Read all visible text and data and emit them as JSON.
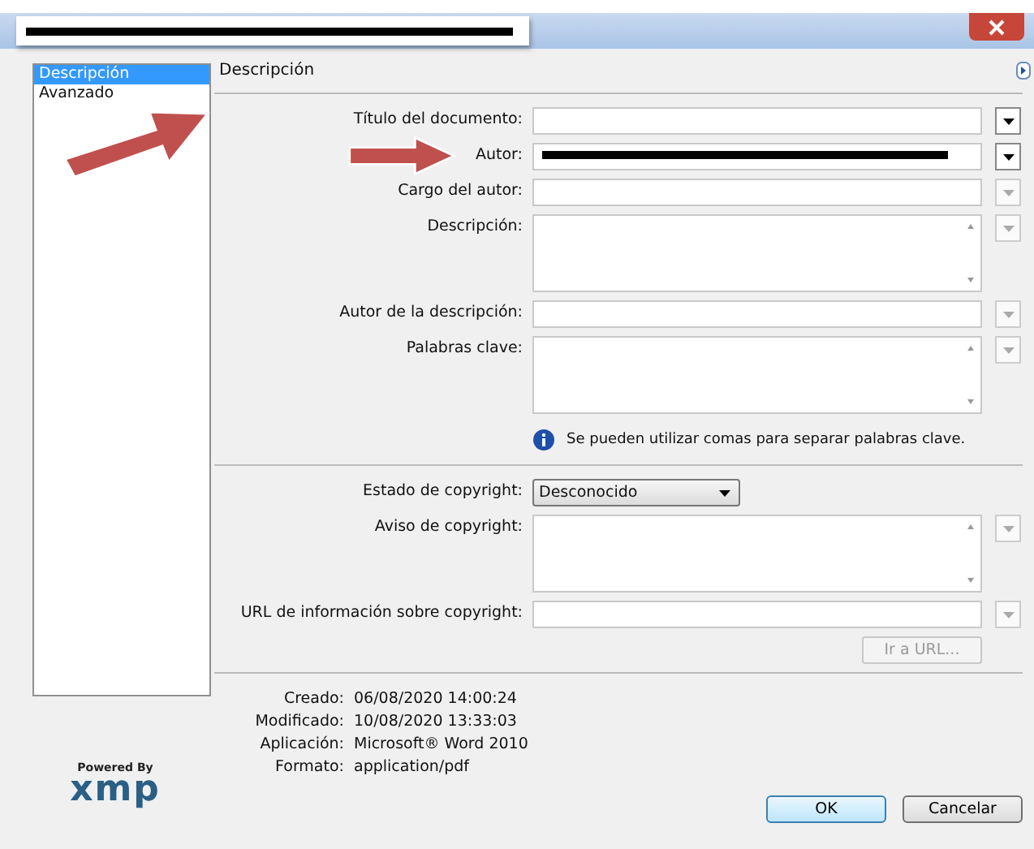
{
  "sidebar": {
    "items": [
      {
        "label": "Descripción",
        "selected": true
      },
      {
        "label": "Avanzado",
        "selected": false
      }
    ]
  },
  "panel": {
    "heading": "Descripción"
  },
  "fields": [
    {
      "label": "Título del documento:",
      "kind": "text",
      "history_enabled": true
    },
    {
      "label": "Autor:",
      "kind": "text",
      "history_enabled": true,
      "redacted": true
    },
    {
      "label": "Cargo del autor:",
      "kind": "text",
      "history_enabled": false
    },
    {
      "label": "Descripción:",
      "kind": "textarea",
      "history_enabled": false
    },
    {
      "label": "Autor de la descripción:",
      "kind": "text",
      "history_enabled": false
    },
    {
      "label": "Palabras clave:",
      "kind": "textarea",
      "history_enabled": false
    },
    {
      "kind": "info",
      "text": "Se pueden utilizar comas para separar palabras clave."
    },
    {
      "kind": "divider"
    },
    {
      "label": "Estado de copyright:",
      "kind": "select",
      "value": "Desconocido"
    },
    {
      "label": "Aviso de copyright:",
      "kind": "textarea",
      "history_enabled": false
    },
    {
      "label": "URL de información sobre copyright:",
      "kind": "text",
      "history_enabled": false
    }
  ],
  "url_button": {
    "label": "Ir a URL...",
    "disabled": true
  },
  "metadata": [
    {
      "label": "Creado:",
      "value": "06/08/2020 14:00:24"
    },
    {
      "label": "Modificado:",
      "value": "10/08/2020 13:33:03"
    },
    {
      "label": "Aplicación:",
      "value": "Microsoft® Word 2010"
    },
    {
      "label": "Formato:",
      "value": "application/pdf"
    }
  ],
  "logo": {
    "tagline": "Powered By",
    "name": "xmp"
  },
  "buttons": [
    {
      "label": "OK",
      "default": true
    },
    {
      "label": "Cancelar",
      "default": false
    }
  ]
}
